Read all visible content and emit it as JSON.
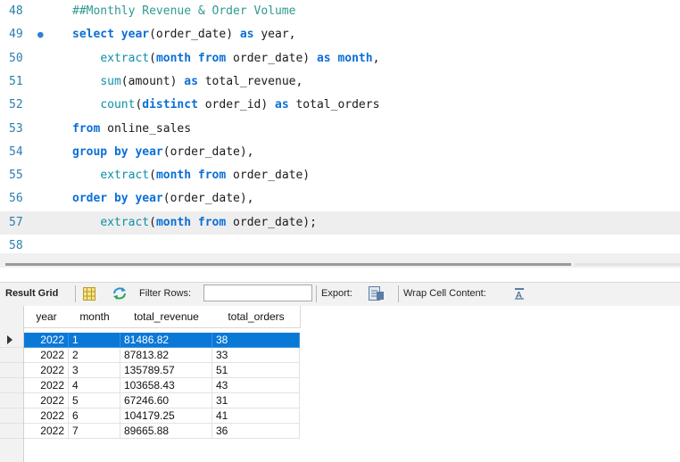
{
  "editor": {
    "lines": [
      {
        "n": "48",
        "tokens": [
          {
            "t": "##Monthly Revenue & Order Volume",
            "c": "cm"
          }
        ]
      },
      {
        "n": "49",
        "breakpoint": true,
        "tokens": [
          {
            "t": "select ",
            "c": "kw"
          },
          {
            "t": "year",
            "c": "kw"
          },
          {
            "t": "(order_date) ",
            "c": ""
          },
          {
            "t": "as",
            "c": "kw"
          },
          {
            "t": " year,",
            "c": ""
          }
        ]
      },
      {
        "n": "50",
        "tokens": [
          {
            "t": "    ",
            "c": ""
          },
          {
            "t": "extract",
            "c": "fn"
          },
          {
            "t": "(",
            "c": ""
          },
          {
            "t": "month",
            "c": "kw"
          },
          {
            "t": " ",
            "c": ""
          },
          {
            "t": "from",
            "c": "kw"
          },
          {
            "t": " order_date) ",
            "c": ""
          },
          {
            "t": "as",
            "c": "kw"
          },
          {
            "t": " ",
            "c": ""
          },
          {
            "t": "month",
            "c": "kw"
          },
          {
            "t": ",",
            "c": ""
          }
        ]
      },
      {
        "n": "51",
        "tokens": [
          {
            "t": "    ",
            "c": ""
          },
          {
            "t": "sum",
            "c": "fn"
          },
          {
            "t": "(amount) ",
            "c": ""
          },
          {
            "t": "as",
            "c": "kw"
          },
          {
            "t": " total_revenue,",
            "c": ""
          }
        ]
      },
      {
        "n": "52",
        "tokens": [
          {
            "t": "    ",
            "c": ""
          },
          {
            "t": "count",
            "c": "fn"
          },
          {
            "t": "(",
            "c": ""
          },
          {
            "t": "distinct",
            "c": "kw"
          },
          {
            "t": " order_id) ",
            "c": ""
          },
          {
            "t": "as",
            "c": "kw"
          },
          {
            "t": " total_orders",
            "c": ""
          }
        ]
      },
      {
        "n": "53",
        "tokens": [
          {
            "t": "from",
            "c": "kw"
          },
          {
            "t": " online_sales",
            "c": ""
          }
        ]
      },
      {
        "n": "54",
        "tokens": [
          {
            "t": "group by",
            "c": "kw"
          },
          {
            "t": " ",
            "c": ""
          },
          {
            "t": "year",
            "c": "kw"
          },
          {
            "t": "(order_date),",
            "c": ""
          }
        ]
      },
      {
        "n": "55",
        "tokens": [
          {
            "t": "    ",
            "c": ""
          },
          {
            "t": "extract",
            "c": "fn"
          },
          {
            "t": "(",
            "c": ""
          },
          {
            "t": "month",
            "c": "kw"
          },
          {
            "t": " ",
            "c": ""
          },
          {
            "t": "from",
            "c": "kw"
          },
          {
            "t": " order_date)",
            "c": ""
          }
        ]
      },
      {
        "n": "56",
        "tokens": [
          {
            "t": "order by",
            "c": "kw"
          },
          {
            "t": " ",
            "c": ""
          },
          {
            "t": "year",
            "c": "kw"
          },
          {
            "t": "(order_date),",
            "c": ""
          }
        ]
      },
      {
        "n": "57",
        "current": true,
        "tokens": [
          {
            "t": "    ",
            "c": ""
          },
          {
            "t": "extract",
            "c": "fn"
          },
          {
            "t": "(",
            "c": ""
          },
          {
            "t": "month",
            "c": "kw"
          },
          {
            "t": " ",
            "c": ""
          },
          {
            "t": "from",
            "c": "kw"
          },
          {
            "t": " order_date);",
            "c": ""
          }
        ]
      },
      {
        "n": "58",
        "tokens": []
      }
    ]
  },
  "toolbar": {
    "result_grid_label": "Result Grid",
    "filter_rows_label": "Filter Rows:",
    "filter_value": "",
    "export_label": "Export:",
    "wrap_label": "Wrap Cell Content:",
    "icons": [
      "grid-view-icon",
      "refresh-arrows-icon",
      "export-icon",
      "wrap-text-icon"
    ]
  },
  "grid": {
    "columns": [
      "year",
      "month",
      "total_revenue",
      "total_orders"
    ],
    "rows": [
      [
        "2022",
        "1",
        "81486.82",
        "38"
      ],
      [
        "2022",
        "2",
        "87813.82",
        "33"
      ],
      [
        "2022",
        "3",
        "135789.57",
        "51"
      ],
      [
        "2022",
        "4",
        "103658.43",
        "43"
      ],
      [
        "2022",
        "5",
        "67246.60",
        "31"
      ],
      [
        "2022",
        "6",
        "104179.25",
        "41"
      ],
      [
        "2022",
        "7",
        "89665.88",
        "36"
      ]
    ],
    "selected_row": 0
  },
  "colors": {
    "keyword": "#0b6fd6",
    "function": "#0f8fa6",
    "comment": "#2e9a8f",
    "line_number": "#2b7fae",
    "selection": "#0a78d7"
  }
}
